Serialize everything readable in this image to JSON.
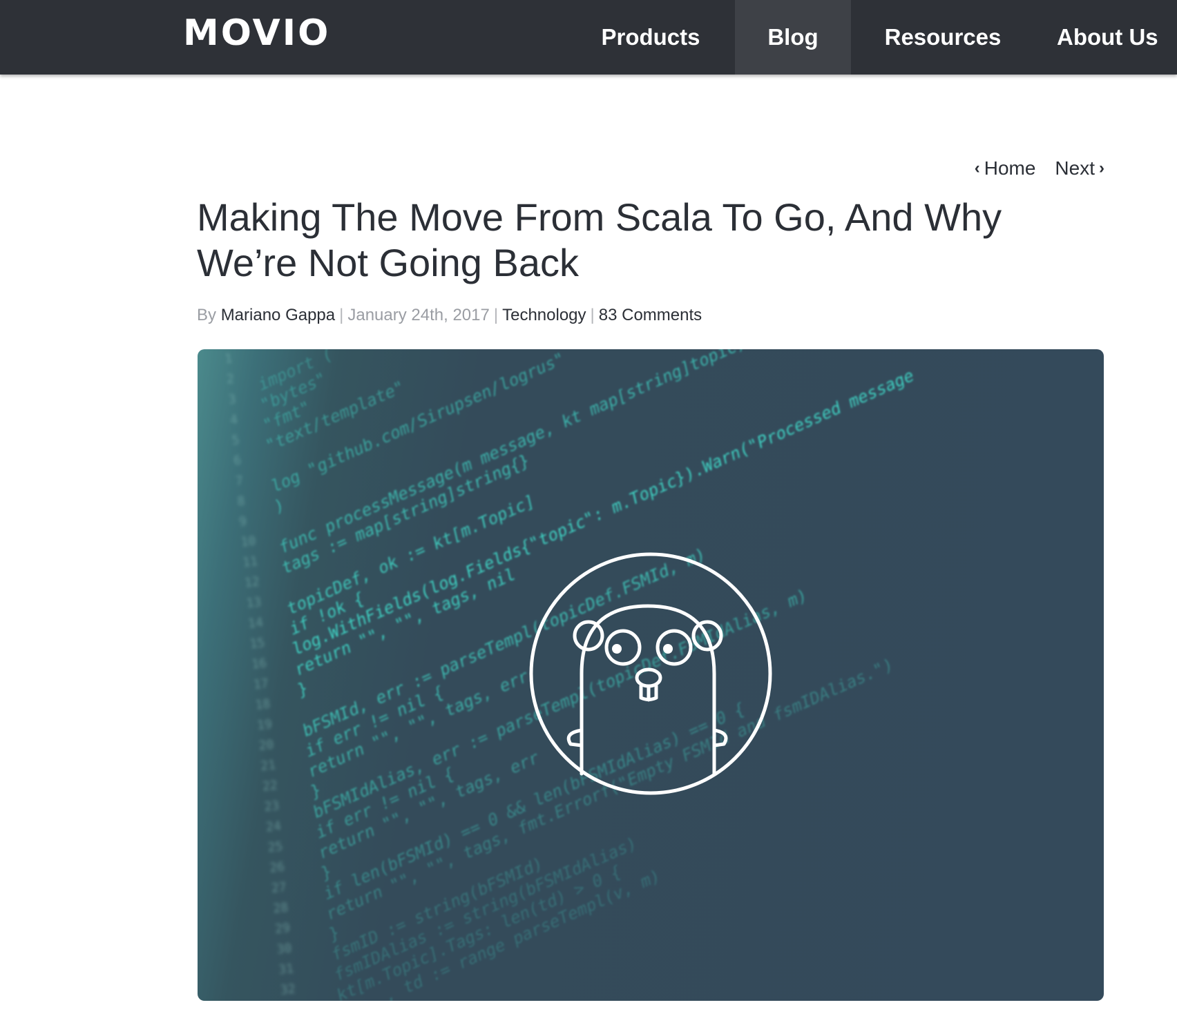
{
  "header": {
    "logo": "MOVIO",
    "nav": [
      {
        "label": "Products"
      },
      {
        "label": "Blog",
        "active": true
      },
      {
        "label": "Resources"
      },
      {
        "label": "About Us"
      }
    ]
  },
  "post_nav": {
    "home_label": "Home",
    "next_label": "Next"
  },
  "article": {
    "title_line1": "Making The Move From Scala To Go, And Why",
    "title_line2": "We’re Not Going Back",
    "by_label": "By",
    "author": "Mariano Gappa",
    "date": "January 24th, 2017",
    "category": "Technology",
    "comments": "83 Comments"
  },
  "hero_image": {
    "line_numbers": [
      "1",
      "2",
      "3",
      "4",
      "5",
      "6",
      "7",
      "8",
      "9",
      "10",
      "11",
      "12",
      "13",
      "14",
      "15",
      "16",
      "17",
      "18",
      "19",
      "20",
      "21",
      "22",
      "23",
      "24",
      "25",
      "26",
      "27",
      "28",
      "29",
      "30",
      "31",
      "32"
    ],
    "code_lines": [
      "import (",
      "  \"bytes\"",
      "  \"fmt\"",
      "  \"text/template\"",
      "",
      "  log \"github.com/Sirupsen/logrus\"",
      ")",
      "",
      "func processMessage(m message, kt map[string]topic) {",
      "  tags := map[string]string{}",
      "",
      "  topicDef, ok := kt[m.Topic]",
      "  if !ok {",
      "    log.WithFields(log.Fields{\"topic\": m.Topic}).Warn(\"Processed message",
      "    return \"\", \"\", tags, nil",
      "  }",
      "",
      "  bFSMId, err := parseTempl(topicDef.FSMId, m)",
      "  if err != nil {",
      "    return \"\", \"\", tags, err",
      "  }",
      "  bFSMIdAlias, err := parseTempl(topicDef.FSMIdAlias, m)",
      "  if err != nil {",
      "    return \"\", \"\", tags, err",
      "  }",
      "  if len(bFSMId) == 0 && len(bFSMIdAlias) == 0 {",
      "    return \"\", \"\", tags, fmt.Errorf(\"Empty FSMId and fsmIDAlias.\")",
      "  }",
      "  fsmID := string(bFSMId)",
      "  fsmIDAlias := string(bFSMIdAlias)",
      "  kt[m.Topic].Tags: len(td) > 0 {",
      "  for _, td := range parseTempl(v, m)"
    ],
    "mascot": "gopher-icon"
  }
}
